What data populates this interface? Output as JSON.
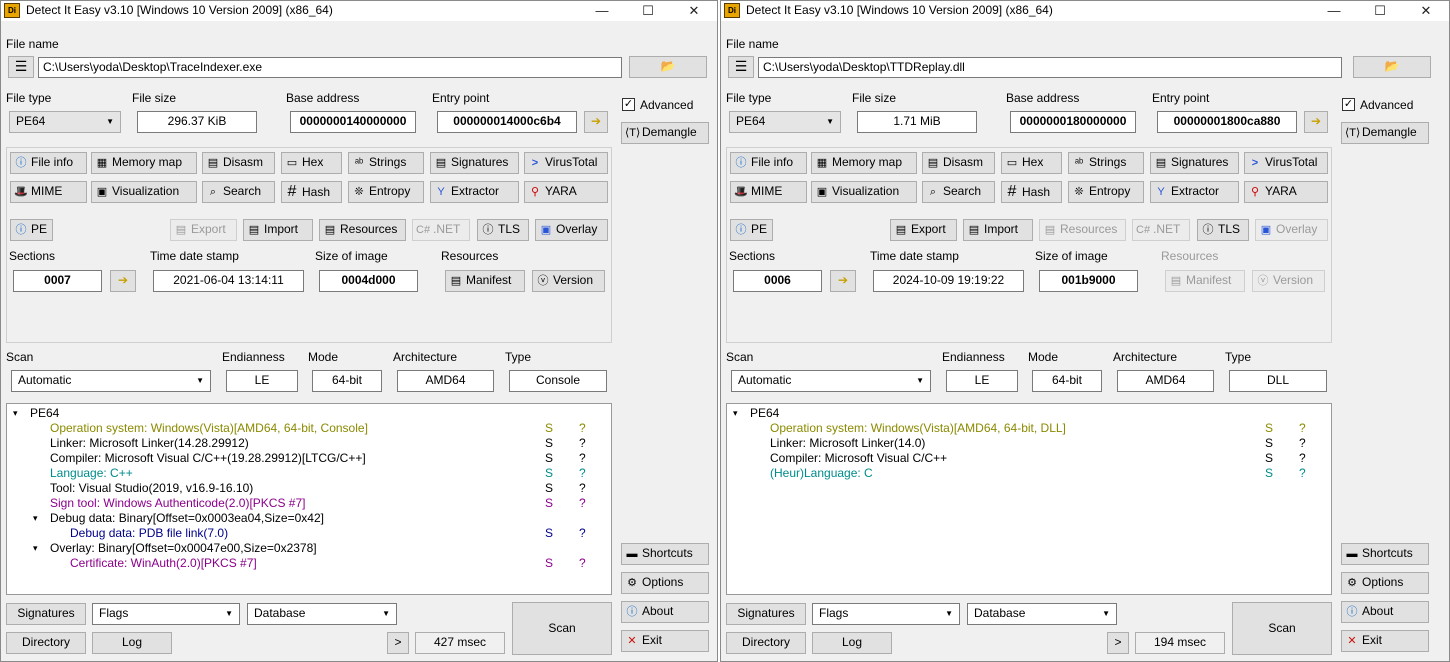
{
  "common": {
    "labels": {
      "file_name": "File name",
      "file_type": "File type",
      "file_size": "File size",
      "base_address": "Base address",
      "entry_point": "Entry point",
      "sections": "Sections",
      "time_date_stamp": "Time date stamp",
      "size_of_image": "Size of image",
      "resources": "Resources",
      "scan": "Scan",
      "endianness": "Endianness",
      "mode": "Mode",
      "architecture": "Architecture",
      "type": "Type"
    },
    "buttons": {
      "advanced": "Advanced",
      "demangle": "Demangle",
      "file_info": "File info",
      "memory_map": "Memory map",
      "disasm": "Disasm",
      "hex": "Hex",
      "strings": "Strings",
      "signatures": "Signatures",
      "virustotal": "VirusTotal",
      "mime": "MIME",
      "visualization": "Visualization",
      "search": "Search",
      "hash": "Hash",
      "entropy": "Entropy",
      "extractor": "Extractor",
      "yara": "YARA",
      "pe": "PE",
      "export": "Export",
      "import": "Import",
      "resources": "Resources",
      "net": ".NET",
      "tls": "TLS",
      "overlay": "Overlay",
      "manifest": "Manifest",
      "version": "Version",
      "shortcuts": "Shortcuts",
      "options": "Options",
      "about": "About",
      "exit": "Exit",
      "bottom_signatures": "Signatures",
      "directory": "Directory",
      "log": "Log",
      "more": ">",
      "scan": "Scan"
    },
    "combos": {
      "flags": "Flags",
      "database": "Database"
    },
    "colors": {
      "yellow_text": "#7a7a00",
      "teal_text": "#008080",
      "purple_text": "#800080",
      "blue_text": "#000080"
    }
  },
  "win1": {
    "title": "Detect It Easy v3.10 [Windows 10 Version 2009] (x86_64)",
    "file_name": "C:\\Users\\yoda\\Desktop\\TraceIndexer.exe",
    "file_type": "PE64",
    "file_size": "296.37 KiB",
    "base_address": "0000000140000000",
    "entry_point": "000000014000c6b4",
    "sections": "0007",
    "time_date_stamp": "2021-06-04 13:14:11",
    "size_of_image": "0004d000",
    "scan_mode": "Automatic",
    "endianness": "LE",
    "mode": "64-bit",
    "architecture": "AMD64",
    "type": "Console",
    "scan_time": "427 msec",
    "tree": [
      {
        "text": "PE64",
        "s": "",
        "q": "",
        "color": "#000000",
        "indent": 0,
        "expander": "▾"
      },
      {
        "text": "Operation system: Windows(Vista)[AMD64, 64-bit, Console]",
        "s": "S",
        "q": "?",
        "color": "#8a8a00",
        "indent": 1,
        "expander": ""
      },
      {
        "text": "Linker: Microsoft Linker(14.28.29912)",
        "s": "S",
        "q": "?",
        "color": "#000000",
        "indent": 1,
        "expander": ""
      },
      {
        "text": "Compiler: Microsoft Visual C/C++(19.28.29912)[LTCG/C++]",
        "s": "S",
        "q": "?",
        "color": "#000000",
        "indent": 1,
        "expander": ""
      },
      {
        "text": "Language: C++",
        "s": "S",
        "q": "?",
        "color": "#008b8b",
        "indent": 1,
        "expander": ""
      },
      {
        "text": "Tool: Visual Studio(2019, v16.9-16.10)",
        "s": "S",
        "q": "?",
        "color": "#000000",
        "indent": 1,
        "expander": ""
      },
      {
        "text": "Sign tool: Windows Authenticode(2.0)[PKCS #7]",
        "s": "S",
        "q": "?",
        "color": "#8b008b",
        "indent": 1,
        "expander": ""
      },
      {
        "text": "Debug data: Binary[Offset=0x0003ea04,Size=0x42]",
        "s": "",
        "q": "",
        "color": "#000000",
        "indent": 1,
        "expander": "▾"
      },
      {
        "text": "Debug data: PDB file link(7.0)",
        "s": "S",
        "q": "?",
        "color": "#00008b",
        "indent": 2,
        "expander": ""
      },
      {
        "text": "Overlay: Binary[Offset=0x00047e00,Size=0x2378]",
        "s": "",
        "q": "",
        "color": "#000000",
        "indent": 1,
        "expander": "▾"
      },
      {
        "text": "Certificate: WinAuth(2.0)[PKCS #7]",
        "s": "S",
        "q": "?",
        "color": "#8b008b",
        "indent": 2,
        "expander": ""
      }
    ]
  },
  "win2": {
    "title": "Detect It Easy v3.10 [Windows 10 Version 2009] (x86_64)",
    "file_name": "C:\\Users\\yoda\\Desktop\\TTDReplay.dll",
    "file_type": "PE64",
    "file_size": "1.71 MiB",
    "base_address": "0000000180000000",
    "entry_point": "00000001800ca880",
    "sections": "0006",
    "time_date_stamp": "2024-10-09 19:19:22",
    "size_of_image": "001b9000",
    "scan_mode": "Automatic",
    "endianness": "LE",
    "mode": "64-bit",
    "architecture": "AMD64",
    "type": "DLL",
    "scan_time": "194 msec",
    "tree": [
      {
        "text": "PE64",
        "s": "",
        "q": "",
        "color": "#000000",
        "indent": 0,
        "expander": "▾"
      },
      {
        "text": "Operation system: Windows(Vista)[AMD64, 64-bit, DLL]",
        "s": "S",
        "q": "?",
        "color": "#8a8a00",
        "indent": 1,
        "expander": ""
      },
      {
        "text": "Linker: Microsoft Linker(14.0)",
        "s": "S",
        "q": "?",
        "color": "#000000",
        "indent": 1,
        "expander": ""
      },
      {
        "text": "Compiler: Microsoft Visual C/C++",
        "s": "S",
        "q": "?",
        "color": "#000000",
        "indent": 1,
        "expander": ""
      },
      {
        "text": "(Heur)Language: C",
        "s": "S",
        "q": "?",
        "color": "#008b8b",
        "indent": 1,
        "expander": ""
      }
    ]
  }
}
